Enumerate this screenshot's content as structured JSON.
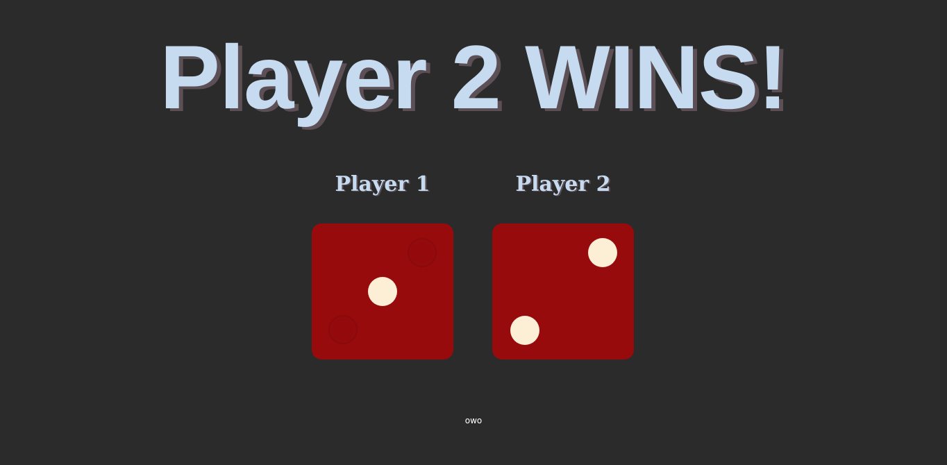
{
  "result": {
    "title": "Player 2 WINS!"
  },
  "players": [
    {
      "label": "Player 1",
      "die_value": 1
    },
    {
      "label": "Player 2",
      "die_value": 2
    }
  ],
  "footer": {
    "text": "owo"
  },
  "colors": {
    "background": "#2b2b2b",
    "title": "#c6dbf0",
    "title_shadow": "#5c4f56",
    "die": "#980b0d",
    "pip": "#fcefd6"
  }
}
